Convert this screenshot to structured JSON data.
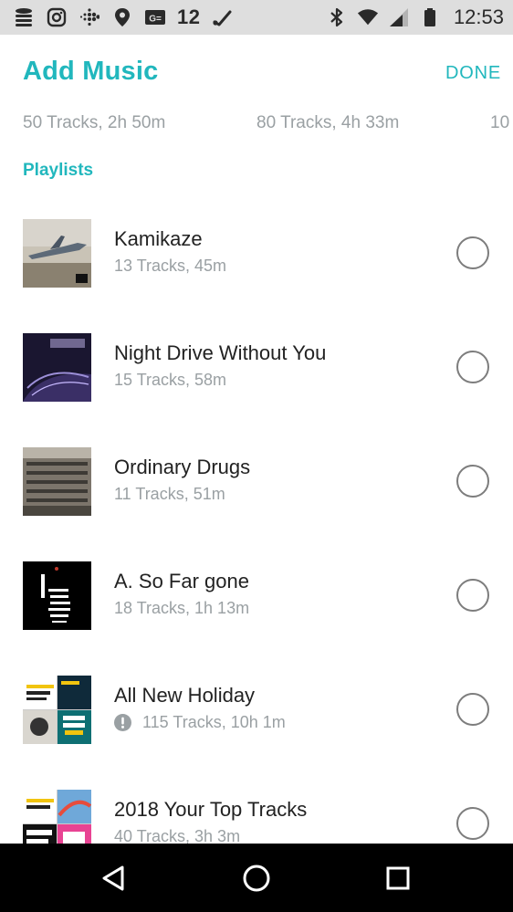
{
  "status_bar": {
    "icons_left": [
      "list-icon",
      "instagram-icon",
      "fitbit-icon",
      "location-pin-icon",
      "gmail-icon"
    ],
    "notification_count": "12",
    "icons_right": [
      "bluetooth-icon",
      "wifi-icon",
      "cellular-signal-icon",
      "battery-icon"
    ],
    "time": "12:53"
  },
  "header": {
    "title": "Add Music",
    "done_label": "DONE"
  },
  "summary": {
    "items": [
      "50 Tracks, 2h 50m",
      "80 Tracks, 4h 33m",
      "10"
    ]
  },
  "section": {
    "title": "Playlists"
  },
  "playlists": [
    {
      "name": "Kamikaze",
      "meta": "13 Tracks, 45m",
      "selected": false,
      "warning": false
    },
    {
      "name": "Night Drive Without You",
      "meta": "15 Tracks, 58m",
      "selected": false,
      "warning": false
    },
    {
      "name": "Ordinary Drugs",
      "meta": "11 Tracks, 51m",
      "selected": false,
      "warning": false
    },
    {
      "name": "A. So Far gone",
      "meta": "18 Tracks, 1h 13m",
      "selected": false,
      "warning": false
    },
    {
      "name": "All New Holiday",
      "meta": "115 Tracks, 10h 1m",
      "selected": false,
      "warning": true
    },
    {
      "name": "2018 Your Top Tracks",
      "meta": "40 Tracks, 3h 3m",
      "selected": false,
      "warning": false
    }
  ],
  "nav": {
    "icons": [
      "back-icon",
      "home-icon",
      "recents-icon"
    ]
  },
  "colors": {
    "accent": "#21b7bd",
    "status_bar_bg": "#dedede",
    "nav_bg": "#000000",
    "secondary_text": "#9aa0a3"
  }
}
